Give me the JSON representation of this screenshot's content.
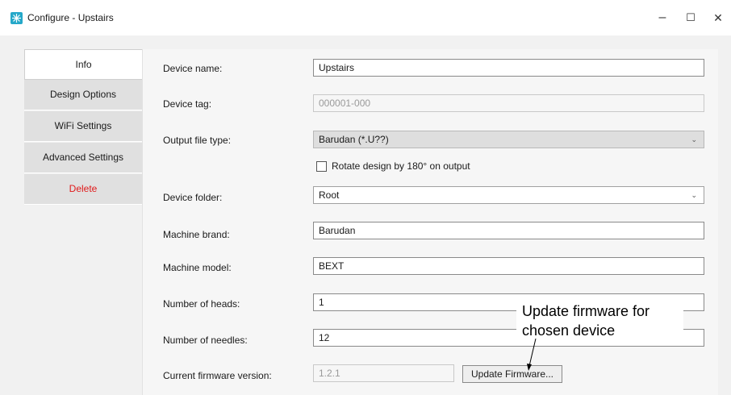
{
  "window": {
    "title": "Configure - Upstairs",
    "controls": {
      "minimize": "–",
      "maximize": "☐",
      "close": "✕"
    }
  },
  "sidebar": {
    "items": [
      {
        "label": "Info",
        "active": true
      },
      {
        "label": "Design Options"
      },
      {
        "label": "WiFi Settings"
      },
      {
        "label": "Advanced Settings"
      },
      {
        "label": "Delete",
        "color": "#e0191a"
      }
    ]
  },
  "form": {
    "device_name": {
      "label": "Device name:",
      "value": "Upstairs"
    },
    "device_tag": {
      "label": "Device tag:",
      "value": "000001-000"
    },
    "output_file_type": {
      "label": "Output file type:",
      "value": "Barudan (*.U??)"
    },
    "rotate": {
      "label": "Rotate design by 180° on output",
      "checked": false
    },
    "device_folder": {
      "label": "Device folder:",
      "value": "Root"
    },
    "machine_brand": {
      "label": "Machine brand:",
      "value": "Barudan"
    },
    "machine_model": {
      "label": "Machine model:",
      "value": "BEXT"
    },
    "number_of_heads": {
      "label": "Number of heads:",
      "value": "1"
    },
    "number_of_needles": {
      "label": "Number of needles:",
      "value": "12"
    },
    "firmware": {
      "label": "Current firmware version:",
      "value": "1.2.1",
      "button": "Update Firmware..."
    }
  },
  "annotation": {
    "line1": "Update firmware for",
    "line2": "chosen device"
  },
  "colors": {
    "accent": "#25a8c9",
    "delete": "#e0191a"
  }
}
